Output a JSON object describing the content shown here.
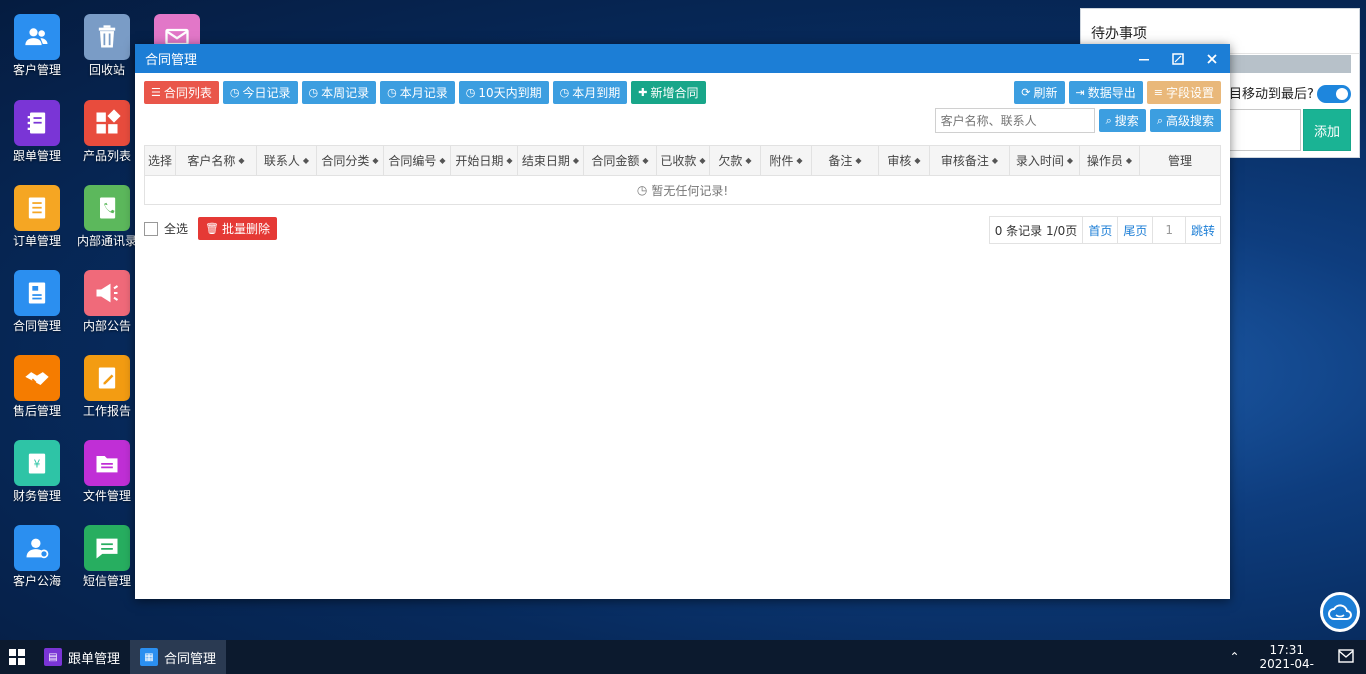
{
  "desktop": {
    "icons": [
      {
        "label": "客户管理",
        "color": "#2b8ff0",
        "icon": "users-icon"
      },
      {
        "label": "回收站",
        "color": "#7a9cc6",
        "icon": "trash-icon"
      },
      {
        "label": "",
        "color": "#e277c8",
        "icon": "mail-icon"
      },
      {
        "label": "跟单管理",
        "color": "#7a35d6",
        "icon": "notebook-icon"
      },
      {
        "label": "产品列表",
        "color": "#e84c3d",
        "icon": "grid-icon"
      },
      {
        "label": "订单管理",
        "color": "#f5a623",
        "icon": "document-icon"
      },
      {
        "label": "内部通讯录",
        "color": "#5cb85c",
        "icon": "phone-book-icon"
      },
      {
        "label": "合同管理",
        "color": "#2b8ff0",
        "icon": "contract-icon"
      },
      {
        "label": "内部公告",
        "color": "#f06a7a",
        "icon": "megaphone-icon"
      },
      {
        "label": "售后管理",
        "color": "#f57c00",
        "icon": "handshake-icon"
      },
      {
        "label": "工作报告",
        "color": "#f39c12",
        "icon": "report-icon"
      },
      {
        "label": "财务管理",
        "color": "#2ec4a6",
        "icon": "finance-icon"
      },
      {
        "label": "文件管理",
        "color": "#c02fd6",
        "icon": "folder-icon"
      },
      {
        "label": "客户公海",
        "color": "#2b8ff0",
        "icon": "user-pool-icon"
      },
      {
        "label": "短信管理",
        "color": "#27ae60",
        "icon": "sms-icon"
      }
    ]
  },
  "todo": {
    "title": "待办事项",
    "move_label": "目移动到最后?",
    "add_label": "添加"
  },
  "window": {
    "title": "合同管理",
    "toolbar": {
      "list": "合同列表",
      "today": "今日记录",
      "week": "本周记录",
      "month": "本月记录",
      "ten_days": "10天内到期",
      "month_due": "本月到期",
      "add": "新增合同",
      "refresh": "刷新",
      "export": "数据导出",
      "fields": "字段设置"
    },
    "search": {
      "placeholder": "客户名称、联系人",
      "search": "搜索",
      "advanced": "高级搜索"
    },
    "columns": [
      "选择",
      "客户名称",
      "联系人",
      "合同分类",
      "合同编号",
      "开始日期",
      "结束日期",
      "合同金额",
      "已收款",
      "欠款",
      "附件",
      "备注",
      "审核",
      "审核备注",
      "录入时间",
      "操作员",
      "管理"
    ],
    "empty_text": "暂无任何记录!",
    "select_all": "全选",
    "batch_delete": "批量删除",
    "pager": {
      "summary": "0 条记录 1/0页",
      "first": "首页",
      "last": "尾页",
      "page": "1",
      "jump": "跳转"
    }
  },
  "taskbar": {
    "items": [
      {
        "label": "跟单管理",
        "color": "#7a35d6"
      },
      {
        "label": "合同管理",
        "color": "#2b8ff0"
      }
    ],
    "time": "17:31",
    "date": "2021-04-"
  }
}
